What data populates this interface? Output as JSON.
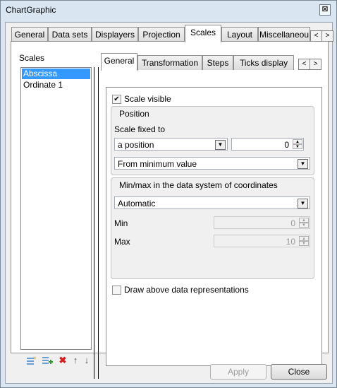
{
  "window": {
    "title": "ChartGraphic",
    "close_glyph": "⊠"
  },
  "top_tabs": [
    {
      "label": "General"
    },
    {
      "label": "Data sets"
    },
    {
      "label": "Displayers"
    },
    {
      "label": "Projection"
    },
    {
      "label": "Scales"
    },
    {
      "label": "Layout"
    },
    {
      "label": "Miscellaneou"
    }
  ],
  "top_tabs_active": "Scales",
  "scroll_left": "<",
  "scroll_right": ">",
  "scales_panel": {
    "label": "Scales",
    "items": [
      {
        "label": "Abscissa"
      },
      {
        "label": "Ordinate 1"
      }
    ],
    "selected": "Abscissa",
    "toolbar_icons": [
      "add-scale-icon",
      "add-scale-green-icon",
      "delete-icon",
      "move-up-icon",
      "move-down-icon"
    ]
  },
  "sub_tabs": [
    {
      "label": "General"
    },
    {
      "label": "Transformation"
    },
    {
      "label": "Steps"
    },
    {
      "label": "Ticks display"
    }
  ],
  "sub_tabs_active": "General",
  "general": {
    "scale_visible_label": "Scale visible",
    "scale_visible_checked": true,
    "position": {
      "title": "Position",
      "fixed_to_label": "Scale fixed to",
      "fixed_to_value": "a position",
      "position_value": "0",
      "reference_value": "From minimum value"
    },
    "minmax": {
      "title": "Min/max in the data system of coordinates",
      "mode_value": "Automatic",
      "min_label": "Min",
      "min_value": "0",
      "max_label": "Max",
      "max_value": "10"
    },
    "draw_above_label": "Draw above data representations",
    "draw_above_checked": false
  },
  "buttons": {
    "apply": "Apply",
    "close": "Close"
  },
  "colors": {
    "selection": "#3399ff",
    "frame": "#d9e6f2"
  }
}
